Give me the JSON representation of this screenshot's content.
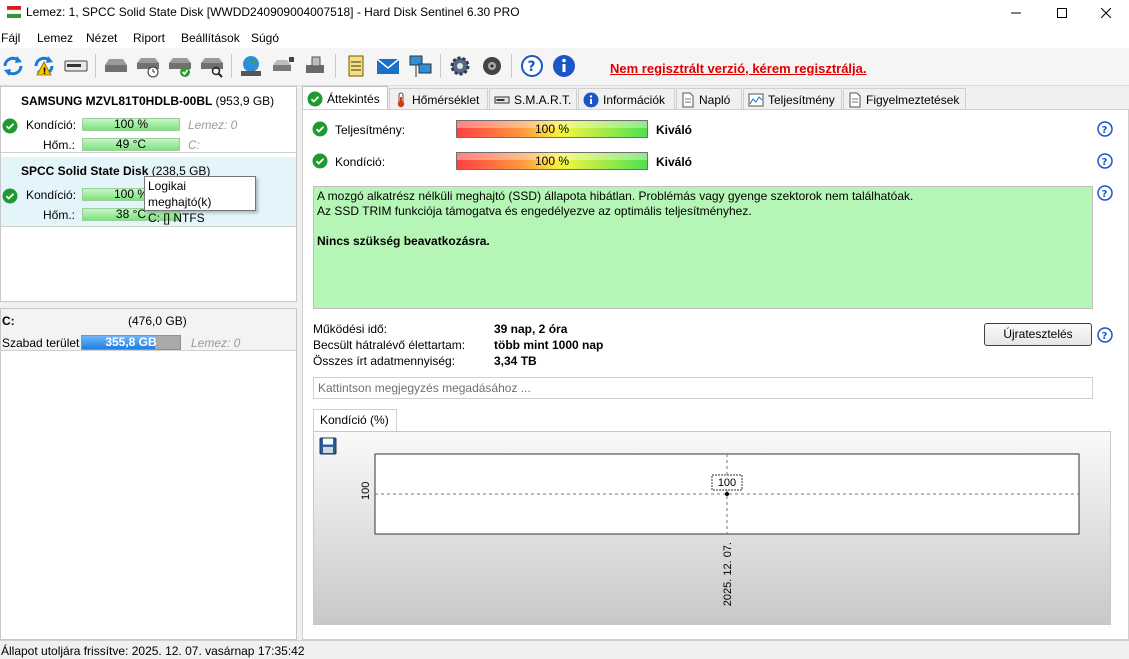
{
  "window": {
    "title": "Lemez: 1, SPCC Solid State Disk [WWDD240909004007518]  -  Hard Disk Sentinel 6.30 PRO"
  },
  "menu": [
    "Fájl",
    "Lemez",
    "Nézet",
    "Riport",
    "Beállítások",
    "Súgó"
  ],
  "toolbar": {
    "register_link": "Nem regisztrált verzió, kérem regisztrálja.",
    "icons": [
      "refresh-icon",
      "refresh-warning-icon",
      "disk-icon",
      "disk-gray-icon",
      "disk-clock-icon",
      "disk-check-icon",
      "disk-search-icon",
      "globe-icon",
      "disk-network-icon",
      "usb-icon",
      "notepad-icon",
      "mail-icon",
      "network-icon",
      "gear-icon",
      "speaker-icon",
      "help-icon",
      "info-icon"
    ]
  },
  "disks": [
    {
      "name": "SAMSUNG MZVL81T0HDLB-00BL",
      "size": "(953,9 GB)",
      "condition_label": "Kondíció:",
      "condition_value": "100 %",
      "temp_label": "Hőm.:",
      "temp_value": "49 °C",
      "drive_prefix": "Lemez: 0",
      "volume": "C:"
    },
    {
      "name": "SPCC Solid State Disk",
      "size": "(238,5 GB)",
      "condition_label": "Kondíció:",
      "condition_value": "100 %",
      "temp_label": "Hőm.:",
      "temp_value": "38 °C"
    }
  ],
  "tooltip": {
    "line1": "Logikai meghajtó(k)",
    "line2": "C: [] NTFS"
  },
  "volume": {
    "name": "C:",
    "size": "(476,0 GB)",
    "free_label": "Szabad terület",
    "free_value": "355,8 GB",
    "free_fraction": 0.747,
    "disk": "Lemez: 0"
  },
  "tabs": [
    "Áttekintés",
    "Hőmérséklet",
    "S.M.A.R.T.",
    "Információk",
    "Napló",
    "Teljesítmény",
    "Figyelmeztetések"
  ],
  "overview": {
    "performance_label": "Teljesítmény:",
    "performance_value": "100 %",
    "performance_rating": "Kiváló",
    "condition_label": "Kondíció:",
    "condition_value": "100 %",
    "condition_rating": "Kiváló",
    "status_line1": "A mozgó alkatrész nélküli meghajtó (SSD) állapota hibátlan. Problémás vagy gyenge szektorok nem találhatóak.",
    "status_line2": "Az SSD TRIM funkciója támogatva és engedélyezve az optimális teljesítményhez.",
    "status_bold": "Nincs szükség beavatkozásra.",
    "uptime_label": "Működési idő:",
    "uptime_value": "39 nap, 2 óra",
    "remaining_label": "Becsült hátralévő élettartam:",
    "remaining_value": "több mint 1000 nap",
    "written_label": "Összes írt adatmennyiség:",
    "written_value": "3,34 TB",
    "retest_button": "Újratesztelés",
    "note_placeholder": "Kattintson megjegyzés megadásához ...",
    "chart_tab": "Kondíció  (%)"
  },
  "chart_data": {
    "type": "line",
    "x": [
      "2025. 12. 07."
    ],
    "series": [
      {
        "values": [
          100
        ]
      }
    ],
    "y_tick": "100",
    "data_label": "100"
  },
  "statusbar": {
    "text": "Állapot utoljára frissítve: 2025. 12. 07. vasárnap 17:35:42"
  },
  "colors": {
    "register": "#e00000",
    "status_bg": "#b5f5b5",
    "ok_green": "#1f9a2e",
    "help_blue": "#1a56c8"
  }
}
